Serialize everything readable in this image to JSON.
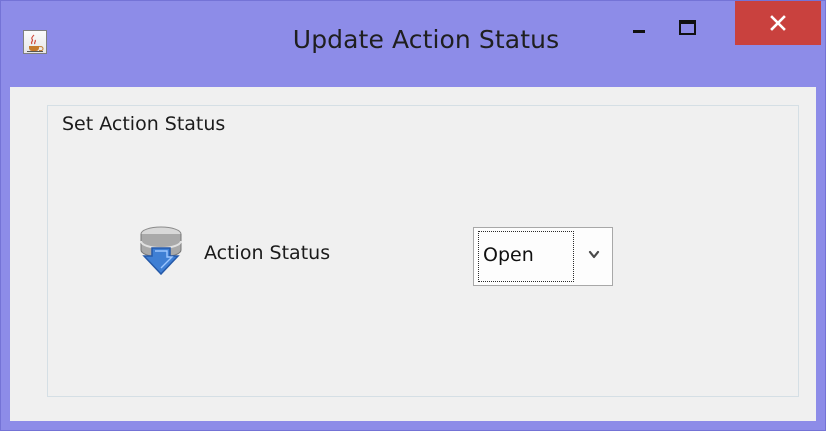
{
  "window": {
    "title": "Update Action Status",
    "app_icon": "java-cup-icon",
    "controls": {
      "minimize": "minimize-icon",
      "maximize": "maximize-icon",
      "close": "close-icon"
    },
    "accent": "#8d8ce8",
    "close_color": "#c9413e"
  },
  "group": {
    "title": "Set Action Status"
  },
  "form": {
    "status_label": "Action Status",
    "status_icon": "database-download-icon",
    "status_value": "Open",
    "dropdown_icon": "chevron-down-icon"
  }
}
